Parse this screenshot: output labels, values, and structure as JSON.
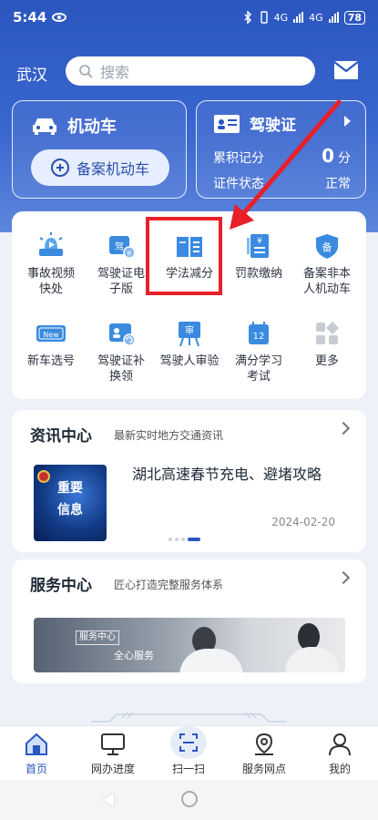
{
  "status_bar": {
    "time": "5:44",
    "network_a": "4G",
    "network_b": "4G",
    "battery": "78"
  },
  "header": {
    "city": "武汉",
    "search_placeholder": "搜索",
    "mail_icon": "mail-icon"
  },
  "vehicle_card": {
    "title": "机动车",
    "add_button": "备案机动车"
  },
  "license_card": {
    "title": "驾驶证",
    "points_label": "累积记分",
    "points_value": "0",
    "points_unit": "分",
    "status_label": "证件状态",
    "status_value": "正常"
  },
  "services": [
    {
      "label_l1": "事故视频",
      "label_l2": "快处",
      "icon": "accident-video-icon"
    },
    {
      "label_l1": "驾驶证电",
      "label_l2": "子版",
      "icon": "e-license-icon"
    },
    {
      "label_l1": "学法减分",
      "label_l2": "",
      "icon": "book-icon"
    },
    {
      "label_l1": "罚款缴纳",
      "label_l2": "",
      "icon": "fine-payment-icon"
    },
    {
      "label_l1": "备案非本",
      "label_l2": "人机动车",
      "icon": "register-shield-icon"
    },
    {
      "label_l1": "新车选号",
      "label_l2": "",
      "icon": "new-plate-icon"
    },
    {
      "label_l1": "驾驶证补",
      "label_l2": "换领",
      "icon": "license-reissue-icon"
    },
    {
      "label_l1": "驾驶人审验",
      "label_l2": "",
      "icon": "driver-review-icon"
    },
    {
      "label_l1": "满分学习",
      "label_l2": "考试",
      "icon": "calendar-exam-icon"
    },
    {
      "label_l1": "更多",
      "label_l2": "",
      "icon": "more-grid-icon"
    }
  ],
  "service_icon_glyphs": {
    "register": "备",
    "review": "审",
    "calendar": "12",
    "new_badge": "New",
    "yen": "¥"
  },
  "news": {
    "title": "资讯中心",
    "subtitle": "最新实时地方交通资讯",
    "thumb_line1": "重要",
    "thumb_line2": "信息",
    "headline": "湖北高速春节充电、避堵攻略",
    "date": "2024-02-20"
  },
  "service_center": {
    "title": "服务中心",
    "subtitle": "匠心打造完整服务体系",
    "banner_tag": "服务中心",
    "banner_text": "全心服务"
  },
  "bottom_nav": [
    {
      "label": "首页",
      "icon": "home-icon",
      "active": true
    },
    {
      "label": "网办进度",
      "icon": "monitor-icon",
      "active": false
    },
    {
      "label": "扫一扫",
      "icon": "scan-icon",
      "active": false
    },
    {
      "label": "服务网点",
      "icon": "location-pin-icon",
      "active": false
    },
    {
      "label": "我的",
      "icon": "user-icon",
      "active": false
    }
  ],
  "colors": {
    "brand_blue": "#2b56bf",
    "highlight_red": "#e8202a",
    "icon_blue": "#3a8be0"
  }
}
